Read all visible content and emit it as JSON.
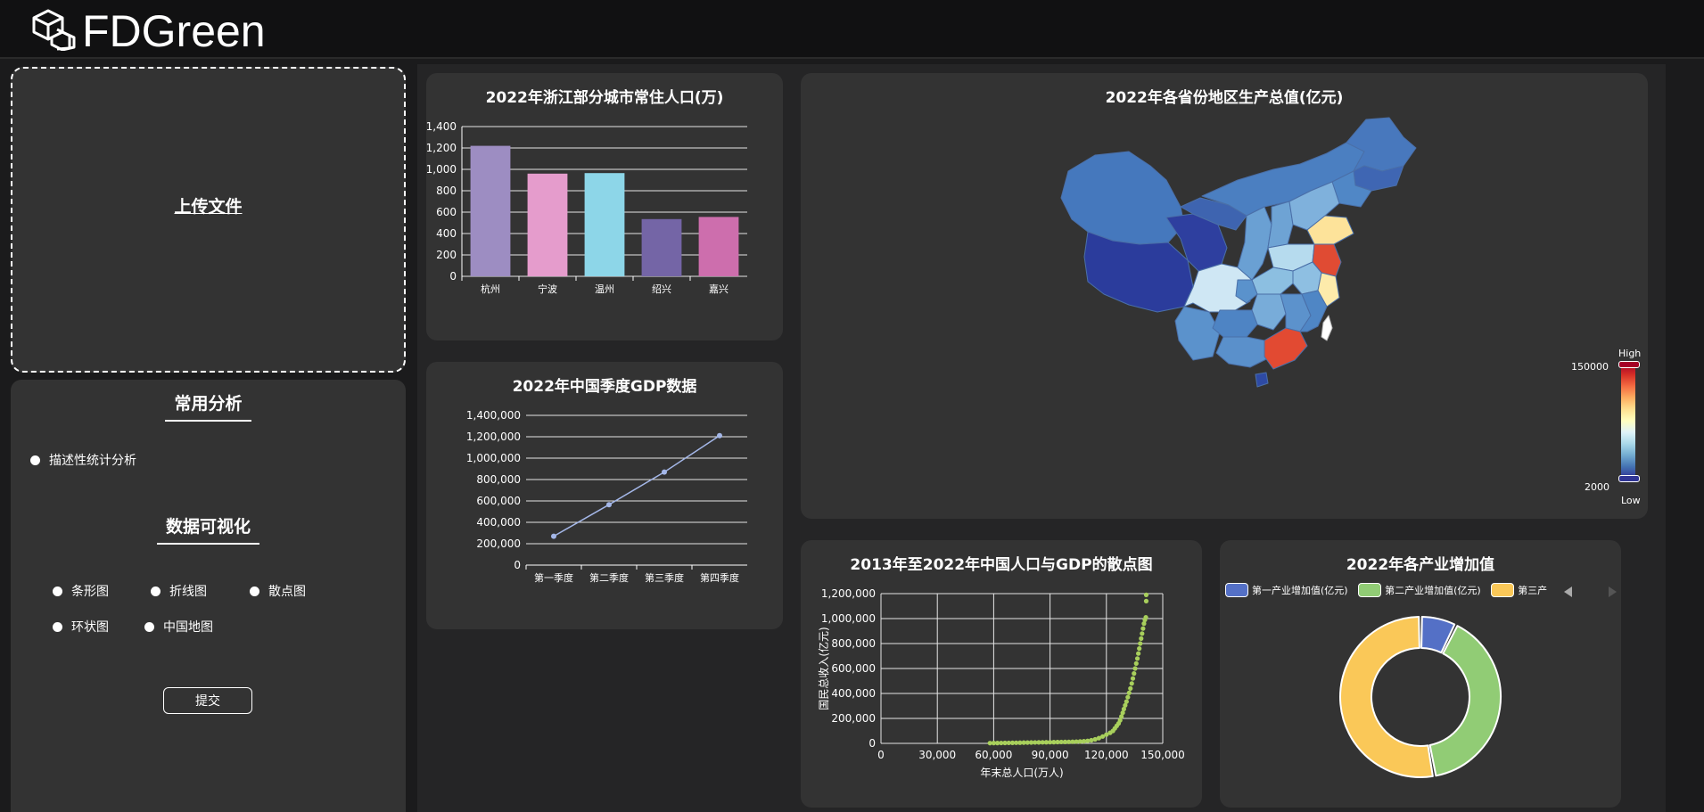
{
  "app": {
    "logo_text": "FDGreen"
  },
  "upload": {
    "label": "上传文件"
  },
  "sidebar": {
    "common_title": "常用分析",
    "common_options": [
      "描述性统计分析"
    ],
    "viz_title": "数据可视化",
    "viz_options": [
      "条形图",
      "折线图",
      "散点图",
      "环状图",
      "中国地图"
    ],
    "submit_label": "提交"
  },
  "colors": {
    "panel": "#333333",
    "background": "#1b1b1c",
    "line": "#a4b7e8",
    "scatter": "#a8cf5c"
  },
  "chart_data": [
    {
      "type": "bar",
      "title": "2022年浙江部分城市常住人口(万)",
      "categories": [
        "杭州",
        "宁波",
        "温州",
        "绍兴",
        "嘉兴"
      ],
      "values": [
        1220,
        960,
        965,
        535,
        555
      ],
      "colors": [
        "#9d8dc2",
        "#e59ccc",
        "#8dd6e8",
        "#7465a6",
        "#cd6ead"
      ],
      "yticks": [
        "0",
        "200",
        "400",
        "600",
        "800",
        "1,000",
        "1,200",
        "1,400"
      ],
      "ylim": [
        0,
        1400
      ]
    },
    {
      "type": "line",
      "title": "2022年中国季度GDP数据",
      "categories": [
        "第一季度",
        "第二季度",
        "第三季度",
        "第四季度"
      ],
      "values": [
        270000,
        565000,
        870000,
        1210000
      ],
      "yticks": [
        "0",
        "200,000",
        "400,000",
        "600,000",
        "800,000",
        "1,000,000",
        "1,200,000",
        "1,400,000"
      ],
      "ylim": [
        0,
        1400000
      ]
    },
    {
      "type": "map",
      "title": "2022年各省份地区生产总值(亿元)",
      "visual_map": {
        "high_label": "High",
        "low_label": "Low",
        "max": "150000",
        "min": "2000"
      }
    },
    {
      "type": "scatter",
      "title": "2013年至2022年中国人口与GDP的散点图",
      "xlabel": "年末总人口(万人)",
      "ylabel": "国民总收入(亿元)",
      "xticks": [
        "0",
        "30,000",
        "60,000",
        "90,000",
        "120,000",
        "150,000"
      ],
      "yticks": [
        "0",
        "200,000",
        "400,000",
        "600,000",
        "800,000",
        "1,000,000",
        "1,200,000"
      ],
      "xlim": [
        0,
        150000
      ],
      "ylim": [
        0,
        1200000
      ],
      "points": [
        [
          58000,
          2000
        ],
        [
          60000,
          2500
        ],
        [
          62000,
          2700
        ],
        [
          64000,
          3000
        ],
        [
          66000,
          3500
        ],
        [
          68000,
          4000
        ],
        [
          70000,
          4500
        ],
        [
          72000,
          5000
        ],
        [
          74000,
          5500
        ],
        [
          76000,
          6000
        ],
        [
          78000,
          6500
        ],
        [
          80000,
          7000
        ],
        [
          82000,
          7500
        ],
        [
          84000,
          8000
        ],
        [
          86000,
          8500
        ],
        [
          88000,
          9000
        ],
        [
          90000,
          9500
        ],
        [
          92000,
          10000
        ],
        [
          94000,
          10500
        ],
        [
          96000,
          11000
        ],
        [
          98000,
          11500
        ],
        [
          100000,
          12000
        ],
        [
          102000,
          13000
        ],
        [
          104000,
          14000
        ],
        [
          106000,
          15000
        ],
        [
          108000,
          17000
        ],
        [
          110000,
          20000
        ],
        [
          112000,
          25000
        ],
        [
          114000,
          32000
        ],
        [
          116000,
          42000
        ],
        [
          118000,
          55000
        ],
        [
          120000,
          70000
        ],
        [
          122000,
          85000
        ],
        [
          123500,
          100000
        ],
        [
          124500,
          120000
        ],
        [
          125500,
          140000
        ],
        [
          126500,
          160000
        ],
        [
          127300,
          185000
        ],
        [
          128000,
          215000
        ],
        [
          128700,
          245000
        ],
        [
          129300,
          275000
        ],
        [
          130000,
          305000
        ],
        [
          130700,
          335000
        ],
        [
          131400,
          370000
        ],
        [
          132100,
          405000
        ],
        [
          132800,
          440000
        ],
        [
          133500,
          480000
        ],
        [
          134100,
          520000
        ],
        [
          134700,
          560000
        ],
        [
          135300,
          600000
        ],
        [
          135900,
          640000
        ],
        [
          136500,
          680000
        ],
        [
          137000,
          720000
        ],
        [
          137500,
          760000
        ],
        [
          138000,
          800000
        ],
        [
          138500,
          840000
        ],
        [
          139000,
          880000
        ],
        [
          139500,
          920000
        ],
        [
          140000,
          960000
        ],
        [
          140500,
          990000
        ],
        [
          141000,
          1010000
        ],
        [
          141200,
          1140000
        ],
        [
          141200,
          1190000
        ]
      ]
    },
    {
      "type": "pie",
      "title": "2022年各产业增加值",
      "legend": [
        "第一产业增加值(亿元)",
        "第二产业增加值(亿元)",
        "第三产业增加值(亿元)"
      ],
      "legend_visible": [
        "第一产业增加值(亿元)",
        "第二产业增加值(亿元)",
        "第三产"
      ],
      "values": [
        88345,
        483164,
        638698
      ],
      "colors": [
        "#5470c6",
        "#91cc75",
        "#fac858"
      ]
    }
  ]
}
